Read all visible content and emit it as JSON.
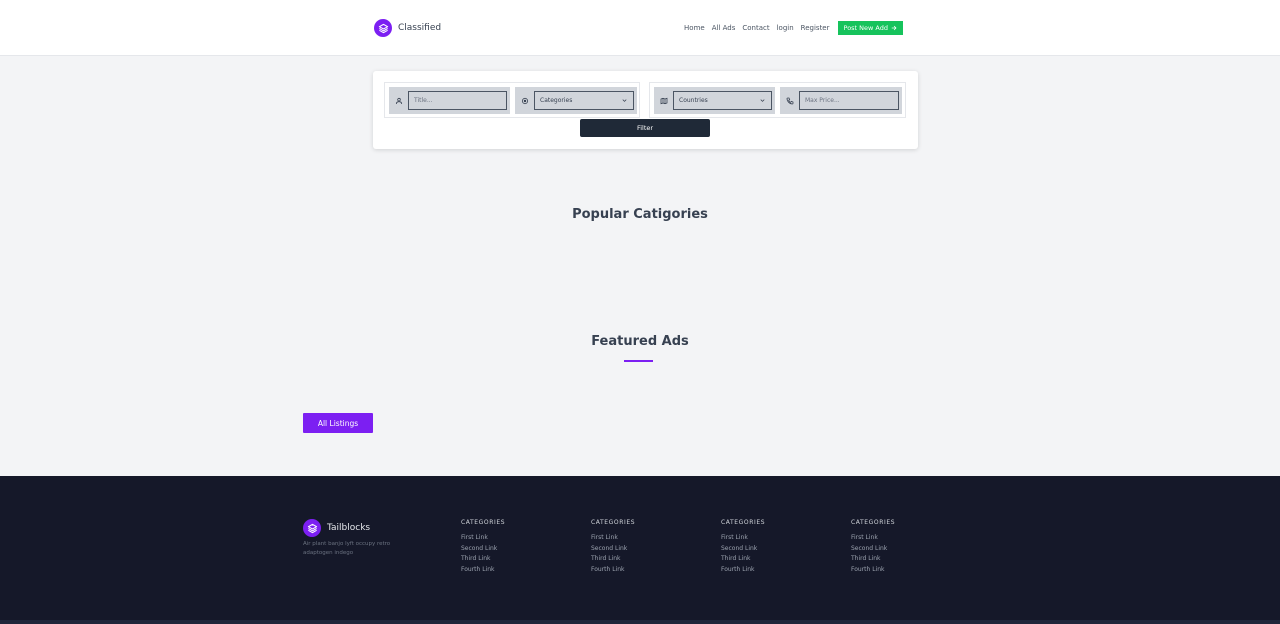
{
  "colors": {
    "brand_purple": "#7c1ff2",
    "post_button_green": "#16c35c",
    "filter_button": "#1f2937",
    "footer_bg": "#151829"
  },
  "header": {
    "brand": {
      "icon": "stack-layers-icon",
      "name": "Classified"
    },
    "nav": [
      {
        "label": "Home"
      },
      {
        "label": "All Ads"
      },
      {
        "label": "Contact"
      },
      {
        "label": "login"
      },
      {
        "label": "Register"
      }
    ],
    "post_button": {
      "label": "Post New Add",
      "icon": "arrow-right-icon"
    }
  },
  "filter": {
    "title_input": {
      "icon": "user-icon",
      "placeholder": "Title..."
    },
    "category_select": {
      "icon": "target-icon",
      "value": "Categories"
    },
    "country_select": {
      "icon": "map-icon",
      "value": "Countries"
    },
    "price_input": {
      "icon": "phone-icon",
      "placeholder": "Max Price..."
    },
    "filter_button": "Filter"
  },
  "sections": {
    "popular_title": "Popular Catigories",
    "featured_title": "Featured Ads",
    "all_listings_button": "All Listings"
  },
  "footer": {
    "brand": {
      "icon": "stack-layers-icon",
      "name": "Tailblocks"
    },
    "tagline": "Air plant banjo lyft occupy retro adaptogen indego",
    "columns": [
      {
        "heading": "CATEGORIES",
        "links": [
          "First Link",
          "Second Link",
          "Third Link",
          "Fourth Link"
        ]
      },
      {
        "heading": "CATEGORIES",
        "links": [
          "First Link",
          "Second Link",
          "Third Link",
          "Fourth Link"
        ]
      },
      {
        "heading": "CATEGORIES",
        "links": [
          "First Link",
          "Second Link",
          "Third Link",
          "Fourth Link"
        ]
      },
      {
        "heading": "CATEGORIES",
        "links": [
          "First Link",
          "Second Link",
          "Third Link",
          "Fourth Link"
        ]
      }
    ]
  }
}
